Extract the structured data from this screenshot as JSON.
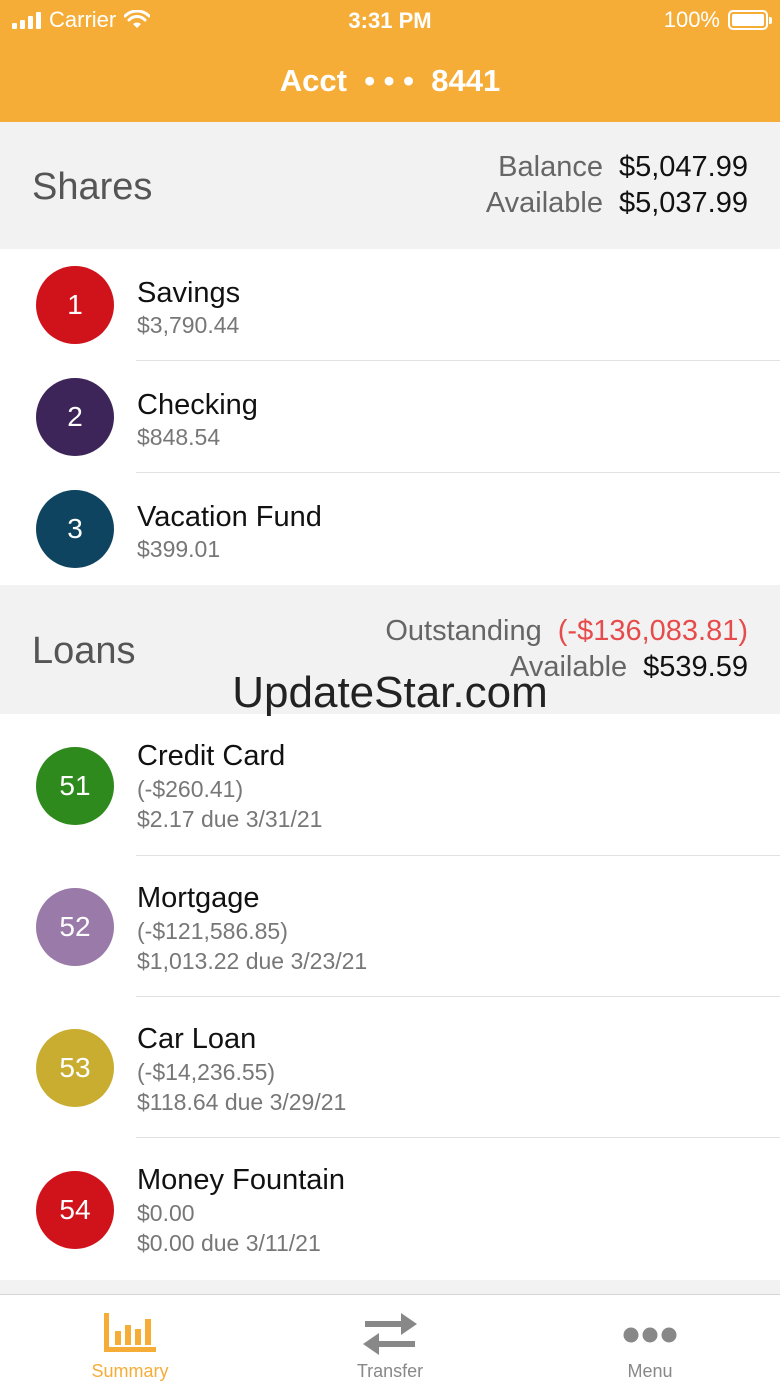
{
  "status_bar": {
    "carrier": "Carrier",
    "time": "3:31 PM",
    "battery": "100%"
  },
  "header": {
    "title": "Acct  • • •  8441"
  },
  "shares": {
    "title": "Shares",
    "balance_label": "Balance",
    "balance_value": "$5,047.99",
    "available_label": "Available",
    "available_value": "$5,037.99",
    "items": [
      {
        "number": "1",
        "name": "Savings",
        "amount": "$3,790.44",
        "color": "#d0121b"
      },
      {
        "number": "2",
        "name": "Checking",
        "amount": "$848.54",
        "color": "#3d2459"
      },
      {
        "number": "3",
        "name": "Vacation Fund",
        "amount": "$399.01",
        "color": "#0e4460"
      }
    ]
  },
  "loans": {
    "title": "Loans",
    "outstanding_label": "Outstanding",
    "outstanding_value": "(-$136,083.81)",
    "available_label": "Available",
    "available_value": "$539.59",
    "items": [
      {
        "number": "51",
        "name": "Credit Card",
        "amount": "(-$260.41)",
        "due": "$2.17 due 3/31/21",
        "color": "#2e8a1c"
      },
      {
        "number": "52",
        "name": "Mortgage",
        "amount": "(-$121,586.85)",
        "due": "$1,013.22 due 3/23/21",
        "color": "#9a7aa8"
      },
      {
        "number": "53",
        "name": "Car Loan",
        "amount": "(-$14,236.55)",
        "due": "$118.64 due 3/29/21",
        "color": "#c9ad30"
      },
      {
        "number": "54",
        "name": "Money Fountain",
        "amount": "$0.00",
        "due": "$0.00 due 3/11/21",
        "color": "#d0121b"
      }
    ]
  },
  "watermark": "UpdateStar.com",
  "tabbar": {
    "summary": "Summary",
    "transfer": "Transfer",
    "menu": "Menu"
  },
  "colors": {
    "accent": "#f6ad38",
    "negative": "#e74c4c",
    "inactive": "#888888"
  }
}
